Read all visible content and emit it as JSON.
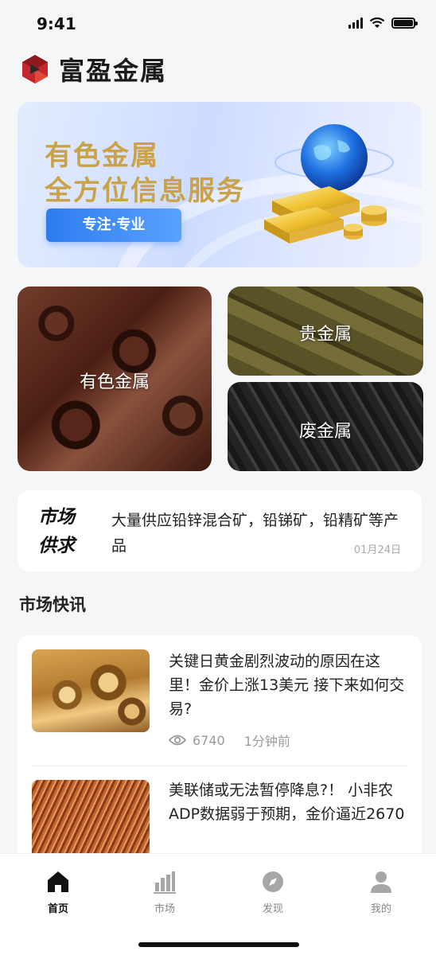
{
  "status": {
    "time": "9:41"
  },
  "app": {
    "title": "富盈金属",
    "logo_icon": "brand-logo-icon"
  },
  "banner": {
    "title_line1": "有色金属",
    "title_line2": "全方位信息服务",
    "button_label": "专注·专业"
  },
  "categories": [
    {
      "label": "有色金属"
    },
    {
      "label": "贵金属"
    },
    {
      "label": "废金属"
    }
  ],
  "supply": {
    "tag_line1": "市场",
    "tag_line2": "供求",
    "text": "大量供应铅锌混合矿，铅锑矿，铅精矿等产品",
    "date": "01月24日"
  },
  "news_section": {
    "title": "市场快讯"
  },
  "news": [
    {
      "title": "关键日黄金剧烈波动的原因在这里！金价上涨13美元 接下来如何交易?",
      "views": "6740",
      "time": "1分钟前",
      "thumb_icon": "brass-pipes-image"
    },
    {
      "title": "美联储或无法暂停降息?！ 小非农ADP数据弱于预期，金价逼近2670",
      "thumb_icon": "copper-wire-image"
    }
  ],
  "tabs": [
    {
      "label": "首页",
      "icon": "home-icon",
      "active": true
    },
    {
      "label": "市场",
      "icon": "bar-chart-icon",
      "active": false
    },
    {
      "label": "发现",
      "icon": "compass-icon",
      "active": false
    },
    {
      "label": "我的",
      "icon": "person-icon",
      "active": false
    }
  ],
  "colors": {
    "accent_blue": "#2d7cf0",
    "banner_gold": "#c9a24a",
    "logo_red": "#c4282e"
  }
}
